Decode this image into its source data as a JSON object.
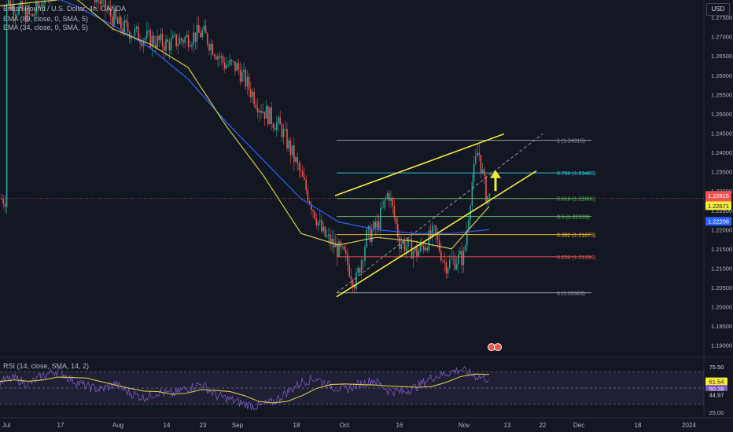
{
  "legend": {
    "title": "British Pound / U.S. Dollar, 4h, OANDA",
    "ema89": "EMA (89, close, 0, SMA, 5)",
    "ema34": "EMA (34, close, 0, SMA, 5)",
    "rsi": "RSI (14, close, SMA, 14, 2)"
  },
  "currency_button": "USD",
  "colors": {
    "background": "#131722",
    "up": "#26a69a",
    "down": "#ef5350",
    "ema89": "#2962ff",
    "ema34": "#d4c74a",
    "channel": "#f5eb3b",
    "rsi": "#7e57c2",
    "rsi_ma": "#d4c74a"
  },
  "chart_data": {
    "type": "candlestick",
    "price_axis": {
      "range": [
        1.1875,
        1.2795
      ],
      "ticks": [
        "1.27500",
        "1.27000",
        "1.26500",
        "1.26000",
        "1.25500",
        "1.25000",
        "1.24500",
        "1.24000",
        "1.23500",
        "1.23000",
        "1.22500",
        "1.22000",
        "1.21500",
        "1.21000",
        "1.20500",
        "1.20000",
        "1.19500",
        "1.19000"
      ]
    },
    "time_axis": {
      "ticks": [
        "Jul",
        "17",
        "Aug",
        "14",
        "23",
        "Sep",
        "18",
        "Oct",
        "16",
        "Nov",
        "13",
        "22",
        "Dec",
        "18",
        "2024"
      ]
    },
    "price_path": [
      [
        "Jul",
        1.279
      ],
      [
        "Jul 10",
        1.275
      ],
      [
        "Jul 17",
        1.287
      ],
      [
        "Jul 24",
        1.283
      ],
      [
        "Aug",
        1.273
      ],
      [
        "Aug 7",
        1.27
      ],
      [
        "Aug 14",
        1.268
      ],
      [
        "Aug 23",
        1.271
      ],
      [
        "Aug 30",
        1.263
      ],
      [
        "Sep",
        1.262
      ],
      [
        "Sep 7",
        1.252
      ],
      [
        "Sep 14",
        1.246
      ],
      [
        "Sep 18",
        1.237
      ],
      [
        "Sep 25",
        1.219
      ],
      [
        "Oct",
        1.213
      ],
      [
        "Oct 3",
        1.206
      ],
      [
        "Oct 6",
        1.218
      ],
      [
        "Oct 9",
        1.221
      ],
      [
        "Oct 12",
        1.23
      ],
      [
        "Oct 16",
        1.217
      ],
      [
        "Oct 20",
        1.214
      ],
      [
        "Oct 24",
        1.219
      ],
      [
        "Oct 27",
        1.211
      ],
      [
        "Nov",
        1.213
      ],
      [
        "Nov 3",
        1.232
      ],
      [
        "Nov 5",
        1.241
      ],
      [
        "Nov 7",
        1.229
      ],
      [
        "Nov 9",
        1.228
      ]
    ],
    "ema_series": [
      {
        "name": "EMA (89, close, 0, SMA, 5)",
        "color": "#2962ff",
        "values": [
          1.283,
          1.282,
          1.278,
          1.273,
          1.267,
          1.259,
          1.248,
          1.238,
          1.228,
          1.222,
          1.22,
          1.219,
          1.219,
          1.22
        ]
      },
      {
        "name": "EMA (34, close, 0, SMA, 5)",
        "color": "#d4c74a",
        "values": [
          1.278,
          1.279,
          1.28,
          1.272,
          1.268,
          1.262,
          1.247,
          1.234,
          1.219,
          1.216,
          1.218,
          1.217,
          1.215,
          1.226
        ]
      }
    ],
    "fibonacci": [
      {
        "level": "1",
        "price": 1.24315,
        "label": "1 (1.24315)",
        "color": "#9598a1"
      },
      {
        "level": "0.786",
        "price": 1.23469,
        "label": "0.786 (1.23469)",
        "color": "#26c6da"
      },
      {
        "level": "0.618",
        "price": 1.22806,
        "label": "0.618 (1.22806)",
        "color": "#4caf50"
      },
      {
        "level": "0.5",
        "price": 1.22339,
        "label": "0.5 (1.22339)",
        "color": "#66bb6a"
      },
      {
        "level": "0.382",
        "price": 1.21873,
        "label": "0.382 (1.21873)",
        "color": "#f0b429"
      },
      {
        "level": "0.236",
        "price": 1.21296,
        "label": "0.236 (1.21296)",
        "color": "#ef5350"
      },
      {
        "level": "0",
        "price": 1.20363,
        "label": "0 (1.20363)",
        "color": "#9598a1"
      }
    ],
    "channel": {
      "upper": [
        [
          "Oct",
          1.2288
        ],
        [
          "Nov 9",
          1.2448
        ]
      ],
      "lower": [
        [
          "Oct",
          1.2026
        ],
        [
          "Nov 16",
          1.2352
        ]
      ],
      "mid_dashed": [
        [
          "Oct",
          1.2036
        ],
        [
          "Nov 20",
          1.2448
        ]
      ]
    },
    "arrow": {
      "direction": "up",
      "at": "Nov 7",
      "from": 1.23,
      "to": 1.2348,
      "color": "#f5eb3b"
    },
    "price_labels": [
      {
        "text": "1.22815",
        "bg": "#ef5350",
        "fg": "#ffffff"
      },
      {
        "text": "01:38:53",
        "bg": "#ef5350",
        "fg": "#ffffff"
      },
      {
        "text": "1.22671",
        "bg": "#f5eb3b",
        "fg": "#131722"
      },
      {
        "text": "1.22206",
        "bg": "#2962ff",
        "fg": "#ffffff"
      }
    ],
    "rsi": {
      "range": [
        20,
        80
      ],
      "levels": [
        70,
        50,
        30
      ],
      "tick_labels": [
        "75.50",
        "25.00"
      ],
      "value_labels": [
        {
          "text": "75.50",
          "bg": "#131722",
          "fg": "#d1d4dc"
        },
        {
          "text": "61.54",
          "bg": "#f5eb3b",
          "fg": "#131722"
        },
        {
          "text": "50.28",
          "bg": "#7e57c2",
          "fg": "#ffffff"
        },
        {
          "text": "44.97",
          "bg": "#131722",
          "fg": "#d1d4dc"
        }
      ],
      "path": [
        58,
        62,
        55,
        65,
        72,
        60,
        52,
        48,
        55,
        44,
        38,
        45,
        42,
        50,
        55,
        41,
        36,
        30,
        27,
        33,
        45,
        58,
        62,
        52,
        48,
        55,
        60,
        47,
        45,
        52,
        63,
        68,
        73,
        65,
        61
      ]
    }
  }
}
